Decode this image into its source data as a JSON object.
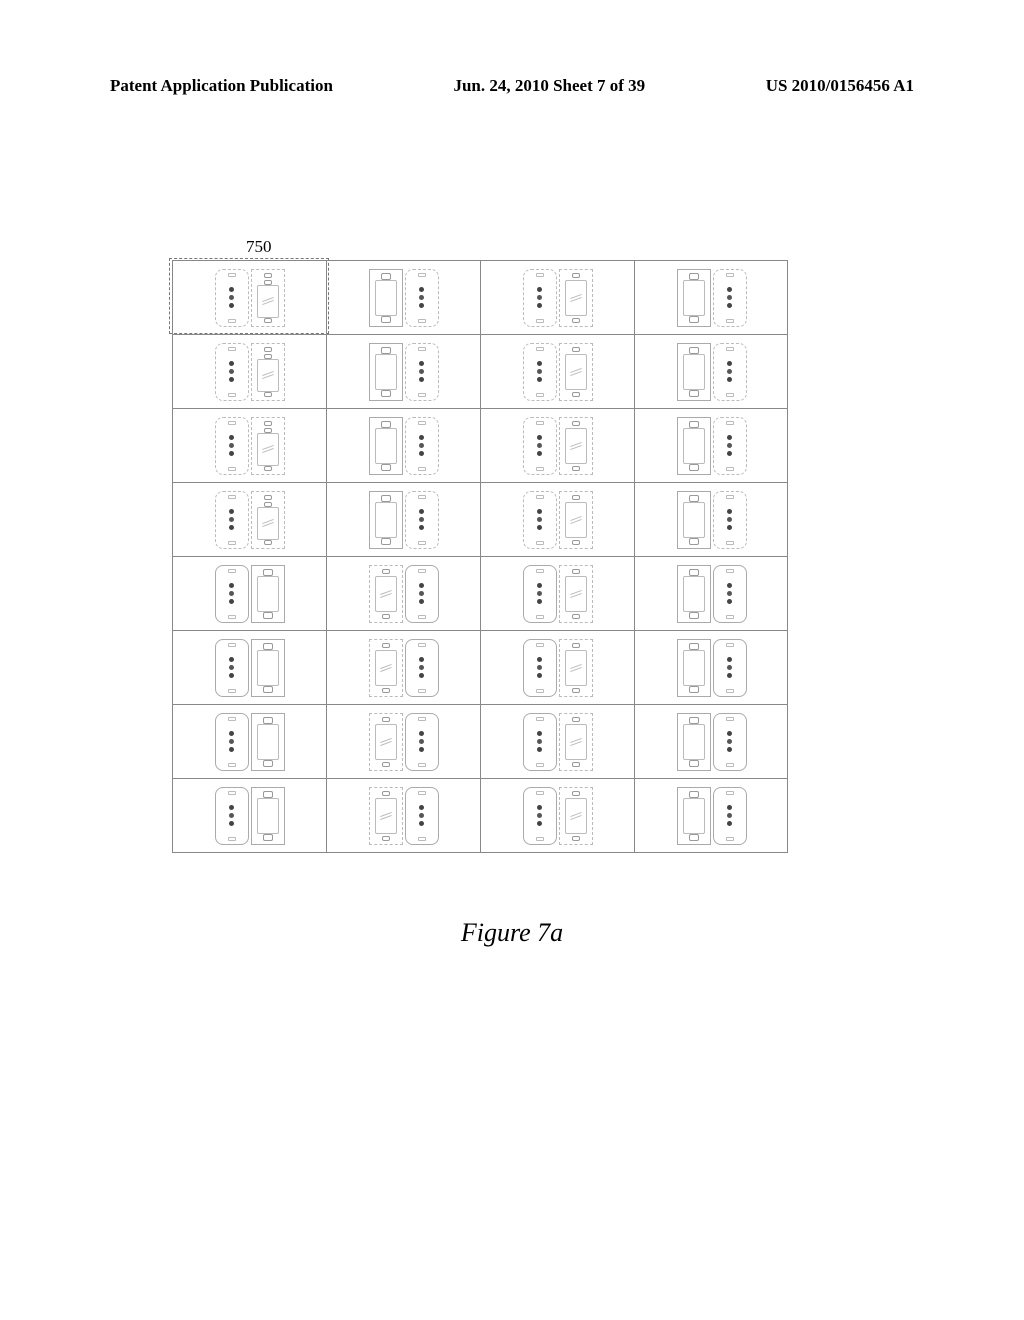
{
  "header": {
    "left": "Patent Application Publication",
    "center": "Jun. 24, 2010  Sheet 7 of 39",
    "right": "US 2010/0156456 A1"
  },
  "figure": {
    "callout_ref": "750",
    "caption": "Figure 7a",
    "grid": {
      "rows": 8,
      "cols": 4
    }
  }
}
